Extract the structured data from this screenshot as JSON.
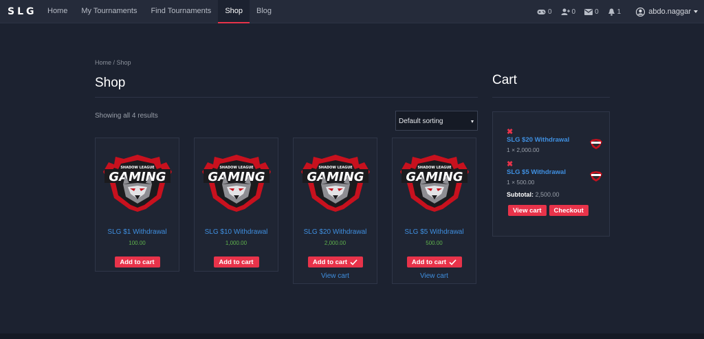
{
  "nav": {
    "logo": "SLG",
    "links": [
      "Home",
      "My Tournaments",
      "Find Tournaments",
      "Shop",
      "Blog"
    ],
    "active_index": 3,
    "counters": [
      {
        "icon": "gamepad-icon",
        "value": "0"
      },
      {
        "icon": "add-friend-icon",
        "value": "0"
      },
      {
        "icon": "envelope-icon",
        "value": "0"
      },
      {
        "icon": "bell-icon",
        "value": "1"
      }
    ],
    "username": "abdo.naggar"
  },
  "breadcrumb": "Home / Shop",
  "page_title": "Shop",
  "results_text": "Showing all 4 results",
  "sort": {
    "selected": "Default sorting"
  },
  "products": [
    {
      "name": "SLG $1 Withdrawal",
      "price": "100.00",
      "button": "Add to cart",
      "added": false,
      "view_cart": ""
    },
    {
      "name": "SLG $10 Withdrawal",
      "price": "1,000.00",
      "button": "Add to cart",
      "added": false,
      "view_cart": ""
    },
    {
      "name": "SLG $20 Withdrawal",
      "price": "2,000.00",
      "button": "Add to cart",
      "added": true,
      "view_cart": "View cart"
    },
    {
      "name": "SLG $5 Withdrawal",
      "price": "500.00",
      "button": "Add to cart",
      "added": true,
      "view_cart": "View cart"
    }
  ],
  "logo_art": {
    "top": "SHADOW LEAGUE",
    "main": "GAMING"
  },
  "cart": {
    "title": "Cart",
    "items": [
      {
        "name": "SLG $20 Withdrawal",
        "qty_price": "1 × 2,000.00"
      },
      {
        "name": "SLG $5 Withdrawal",
        "qty_price": "1 × 500.00"
      }
    ],
    "subtotal_label": "Subtotal:",
    "subtotal_value": "2,500.00",
    "view_cart": "View cart",
    "checkout": "Checkout"
  },
  "colors": {
    "accent": "#e8334a",
    "link": "#3f8fe0",
    "price": "#5fb24c",
    "background": "#1c2230"
  }
}
